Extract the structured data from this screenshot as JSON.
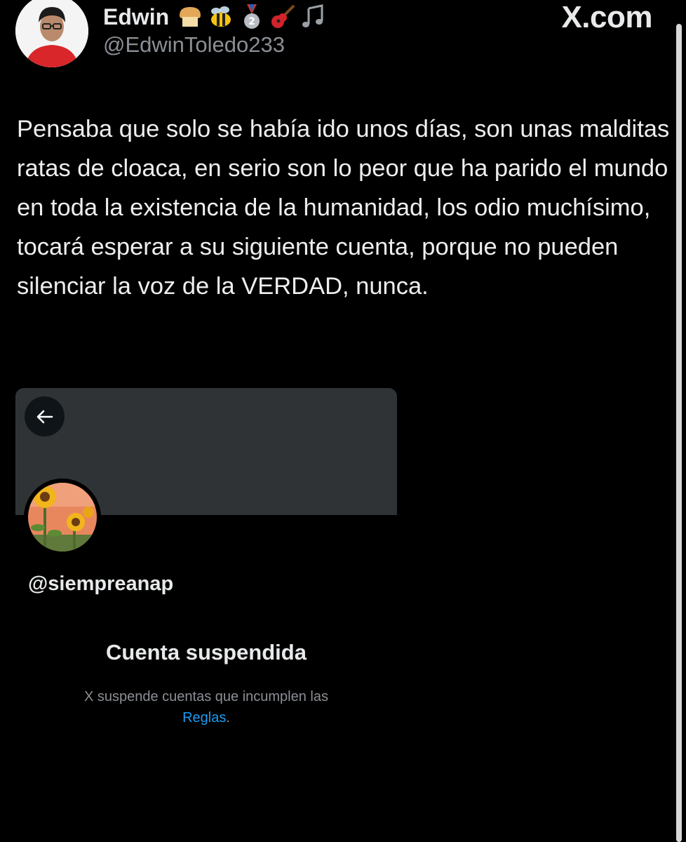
{
  "header": {
    "display_name": "Edwin",
    "handle": "@EdwinToledo233",
    "name_emojis": [
      "bread-icon",
      "bee-icon",
      "medal-2-icon",
      "guitar-icon",
      "music-notes-icon"
    ],
    "brand": "X.com"
  },
  "tweet": {
    "text": "Pensaba que solo se había ido unos días, son unas malditas ratas de cloaca, en serio son lo peor que ha parido el mundo en toda la existencia de la humanidad, los odio muchísimo, tocará esperar a su siguiente cuenta, porque no pueden silenciar la voz de la VERDAD, nunca."
  },
  "embed": {
    "handle": "@siempreanap",
    "title": "Cuenta suspendida",
    "desc_prefix": "X suspende cuentas que incumplen las",
    "rules_link": "Reglas",
    "desc_suffix": "."
  },
  "colors": {
    "background": "#000000",
    "banner": "#2f3336",
    "secondary_text": "#8b8f94",
    "link": "#1d9bf0"
  }
}
